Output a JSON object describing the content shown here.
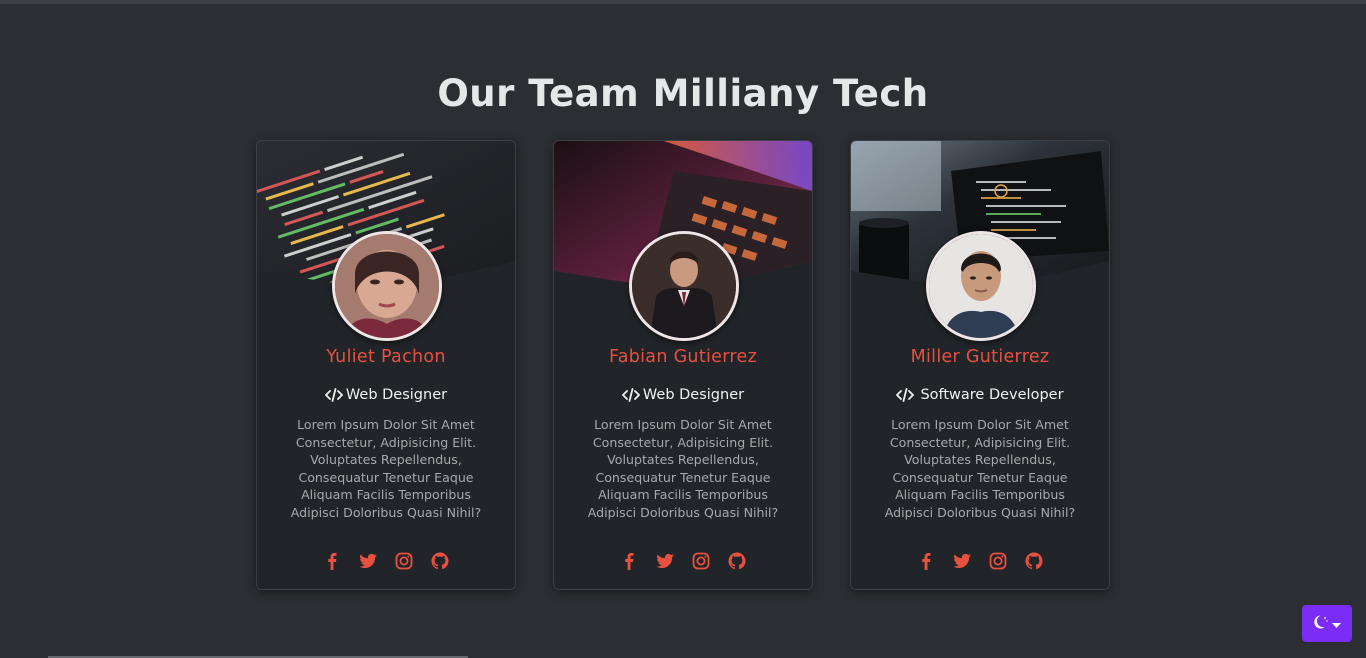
{
  "page": {
    "title": "Our Team Milliany Tech"
  },
  "team": [
    {
      "name": "Yuliet Pachon",
      "role": "Web Designer",
      "description": "Lorem Ipsum Dolor Sit Amet Consectetur, Adipisicing Elit. Voluptates Repellendus, Consequatur Tenetur Eaque Aliquam Facilis Temporibus Adipisci Doloribus Quasi Nihil?",
      "cover": "code-editor-photo",
      "avatar": "woman-portrait-photo"
    },
    {
      "name": "Fabian Gutierrez",
      "role": "Web Designer",
      "description": "Lorem Ipsum Dolor Sit Amet Consectetur, Adipisicing Elit. Voluptates Repellendus, Consequatur Tenetur Eaque Aliquam Facilis Temporibus Adipisci Doloribus Quasi Nihil?",
      "cover": "laptop-keyboard-photo",
      "avatar": "man-in-suit-photo"
    },
    {
      "name": "Miller Gutierrez",
      "role": "Software Developer",
      "description": "Lorem Ipsum Dolor Sit Amet Consectetur, Adipisicing Elit. Voluptates Repellendus, Consequatur Tenetur Eaque Aliquam Facilis Temporibus Adipisci Doloribus Quasi Nihil?",
      "cover": "laptop-with-mug-photo",
      "avatar": "man-portrait-photo"
    }
  ],
  "socials": [
    "facebook-icon",
    "twitter-icon",
    "instagram-icon",
    "github-icon"
  ],
  "theme_toggle": {
    "icon": "moon-icon",
    "caret": "caret-down-icon"
  },
  "colors": {
    "background": "#2b2f33",
    "card": "#212428",
    "accent": "#e8513f",
    "toggle": "#7b2cf5"
  }
}
